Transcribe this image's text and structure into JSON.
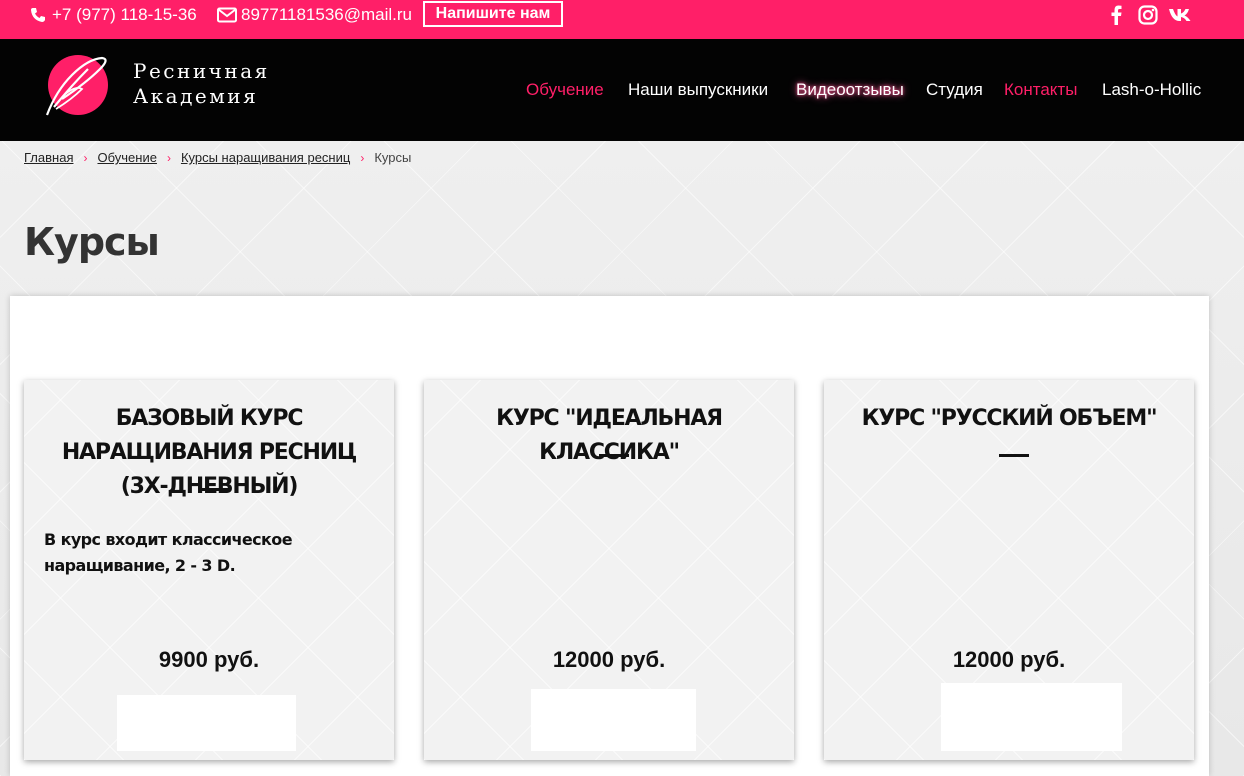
{
  "topbar": {
    "phone": "+7 (977) 118-15-36",
    "email": "89771181536@mail.ru",
    "write_us": "Напишите нам",
    "social": [
      "facebook-icon",
      "instagram-icon",
      "vk-icon"
    ]
  },
  "brand": {
    "line1": "Ресничная",
    "line2": "Академия"
  },
  "nav": [
    "Обучение",
    "Наши выпускники",
    "Видеоотзывы",
    "Студия",
    "Контакты",
    "Lash-o-Hollic"
  ],
  "breadcrumb": [
    "Главная",
    "Обучение",
    "Курсы наращивания ресниц",
    "Курсы"
  ],
  "page_title": "Курсы",
  "courses": [
    {
      "title": "БАЗОВЫЙ КУРС НАРАЩИВАНИЯ РЕСНИЦ (3Х-ДНЕВНЫЙ)",
      "description": "В курс входит классическое наращивание, 2 - 3 D.",
      "price": "9900 руб."
    },
    {
      "title": "КУРС \"ИДЕАЛЬНАЯ КЛАССИКА\"",
      "description": "",
      "price": "12000 руб."
    },
    {
      "title": "КУРС \"РУССКИЙ ОБЪЕМ\"",
      "description": "",
      "price": "12000 руб."
    }
  ],
  "colors": {
    "accent": "#ff1f68",
    "header_bg": "#030303"
  }
}
